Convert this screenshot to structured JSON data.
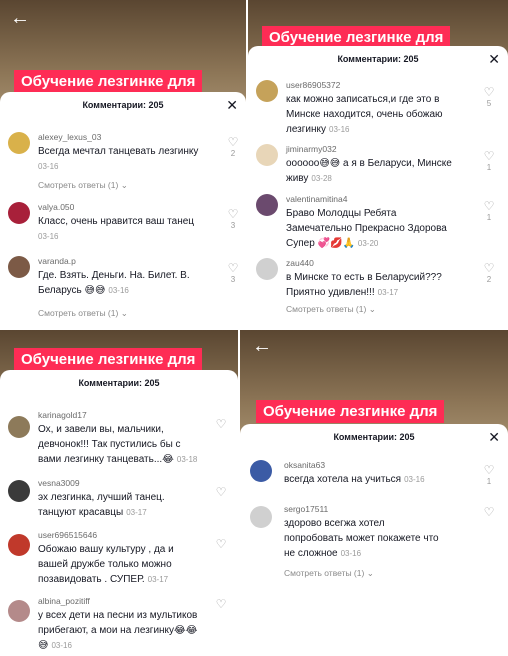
{
  "title": "Обучение лезгинке для",
  "comments_header": "Комментарии: 205",
  "panel_tl": {
    "comments": [
      {
        "user": "alexey_lexus_03",
        "text_lines": [
          "Всегда мечтал танцевать лезгинку"
        ],
        "date": "03-16",
        "likes": "2",
        "replies": "Смотреть ответы (1)",
        "avatar": "#d9b14a"
      },
      {
        "user": "valya.050",
        "text_lines": [
          "Класс, очень нравится ваш танец"
        ],
        "date": "03-16",
        "likes": "3",
        "replies": "",
        "avatar": "#a8203a"
      },
      {
        "user": "varanda.p",
        "text_lines": [
          "Где. Взять. Деньги. На. Билет. В.",
          "Беларусь 😅😅"
        ],
        "date": "03-16",
        "likes": "3",
        "replies": "Смотреть ответы (1)",
        "avatar": "#7c5a46"
      }
    ]
  },
  "panel_tr": {
    "comments": [
      {
        "user": "user86905372",
        "text_lines": [
          "как можно записаться,и где это в",
          "Минске находится, очень обожаю",
          "лезгинку"
        ],
        "date": "03-16",
        "likes": "5",
        "replies": "",
        "avatar": "#c5a25a"
      },
      {
        "user": "jiminarmy032",
        "text_lines": [
          "оооооо😅😅 а я в Беларуси, Минске",
          "живу"
        ],
        "date": "03-28",
        "likes": "1",
        "replies": "",
        "avatar": "#e8d6b8"
      },
      {
        "user": "valentinamitina4",
        "text_lines": [
          "Браво Молодцы Ребята",
          "Замечательно Прекрасно Здорова",
          "Супер 💞💋🙏"
        ],
        "date": "03-20",
        "likes": "1",
        "replies": "",
        "avatar": "#6b4a6e"
      },
      {
        "user": "zau440",
        "text_lines": [
          "в Минске то есть в Беларусий???",
          "Приятно удивлен!!!"
        ],
        "date": "03-17",
        "likes": "2",
        "replies": "Смотреть ответы (1)",
        "avatar": "#d0d0d0"
      }
    ]
  },
  "panel_bl": {
    "comments": [
      {
        "user": "karinagold17",
        "text_lines": [
          "Ох, и завели вы, мальчики,",
          "девчонок!!! Так пустились бы с",
          "вами лезгинку танцевать...😂"
        ],
        "date": "03-18",
        "likes": "",
        "replies": "",
        "avatar": "#8d7a5a"
      },
      {
        "user": "vesna3009",
        "text_lines": [
          "эх лезгинка, лучший танец.",
          "танцуют красавцы"
        ],
        "date": "03-17",
        "likes": "",
        "replies": "",
        "avatar": "#3a3a3a"
      },
      {
        "user": "user696515646",
        "text_lines": [
          "Обожаю вашу культуру , да и",
          "вашей дружбе только можно",
          "позавидовать . СУПЕР."
        ],
        "date": "03-17",
        "likes": "",
        "replies": "",
        "avatar": "#c0392b"
      },
      {
        "user": "albina_pozitiff",
        "text_lines": [
          "у всех дети на песни из мультиков",
          "прибегают, а мои на лезгинку😂😂",
          "😅"
        ],
        "date": "03-16",
        "likes": "",
        "replies": "",
        "avatar": "#b48a8a"
      }
    ]
  },
  "panel_br": {
    "comments": [
      {
        "user": "oksanita63",
        "text_lines": [
          "всегда хотела на учиться"
        ],
        "date": "03-16",
        "likes": "1",
        "replies": "",
        "avatar": "#3b5ba5"
      },
      {
        "user": "sergo17511",
        "text_lines": [
          "здорово всегжа хотел",
          "попробовать может покажете что",
          "не сложное"
        ],
        "date": "03-16",
        "likes": "",
        "replies": "Смотреть ответы (1)",
        "avatar": "#d0d0d0"
      }
    ]
  },
  "icons": {
    "back": "arrow-left-icon",
    "close": "close-icon",
    "like": "heart-outline-icon",
    "chevron": "chevron-down-icon"
  },
  "colors": {
    "accent": "#fe2c55"
  }
}
